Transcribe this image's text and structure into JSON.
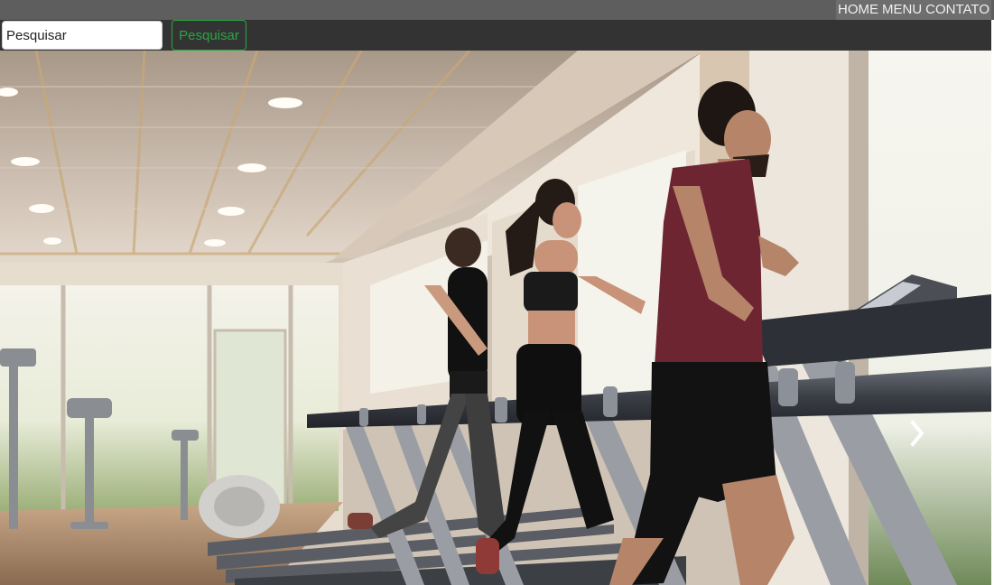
{
  "topnav": {
    "items": [
      "HOME",
      "MENU",
      "CONTATO"
    ]
  },
  "search": {
    "placeholder": "Pesquisar",
    "button_label": "Pesquisar"
  },
  "carousel": {
    "next_icon": "chevron-right-icon"
  },
  "colors": {
    "topbar": "#5e5e5e",
    "searchbar": "#333333",
    "accent_green": "#28a745"
  }
}
